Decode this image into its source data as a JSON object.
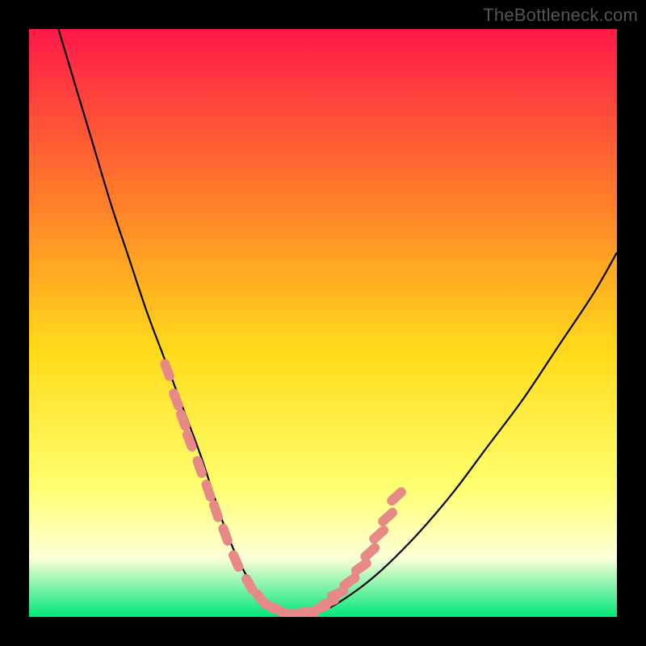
{
  "attribution": "TheBottleneck.com",
  "colors": {
    "frame": "#000000",
    "gradient_top": "#ff1a4a",
    "gradient_mid1": "#ff7a2a",
    "gradient_mid2": "#ffdb1a",
    "gradient_mid3": "#ffff70",
    "gradient_mid4": "#fdffd8",
    "gradient_bottom": "#00e67a",
    "curve": "#000000",
    "marker_fill": "#e78a87",
    "marker_stroke": "#d06a68"
  },
  "chart_data": {
    "type": "line",
    "title": "",
    "xlabel": "",
    "ylabel": "",
    "xlim": [
      0,
      100
    ],
    "ylim": [
      0,
      100
    ],
    "series": [
      {
        "name": "bottleneck-curve",
        "x": [
          5,
          8,
          11,
          14,
          17,
          20,
          23,
          26,
          29,
          31,
          33,
          35,
          37,
          39,
          42,
          46,
          50,
          55,
          60,
          66,
          72,
          78,
          84,
          90,
          96,
          100
        ],
        "y": [
          100,
          90,
          80,
          70,
          61,
          52,
          44,
          36,
          28,
          22,
          16,
          11,
          7,
          4,
          1,
          0,
          1,
          4,
          8,
          14,
          21,
          29,
          37,
          46,
          55,
          62
        ]
      }
    ],
    "markers": {
      "name": "highlighted-segments",
      "x_left": [
        23.5,
        25.0,
        26.2,
        27.3,
        29.0,
        30.5,
        31.8,
        33.4,
        35.2,
        37.5,
        39.5,
        41.0,
        42.8,
        44.5
      ],
      "y_left": [
        42.0,
        37.0,
        33.5,
        30.0,
        25.5,
        21.5,
        18.0,
        14.0,
        9.5,
        5.5,
        3.0,
        1.8,
        1.0,
        0.5
      ],
      "x_right": [
        47.5,
        49.5,
        51.0,
        52.5,
        54.5,
        56.5,
        58.0,
        59.5,
        61.0,
        62.5
      ],
      "y_right": [
        0.8,
        1.5,
        2.5,
        4.0,
        6.0,
        8.5,
        11.0,
        14.0,
        17.0,
        20.5
      ]
    },
    "gradient_stops": [
      {
        "offset": 0.0,
        "color": "#ff1a4a"
      },
      {
        "offset": 0.28,
        "color": "#ff7a2a"
      },
      {
        "offset": 0.55,
        "color": "#ffdb1a"
      },
      {
        "offset": 0.78,
        "color": "#ffff70"
      },
      {
        "offset": 0.9,
        "color": "#fdffd8"
      },
      {
        "offset": 1.0,
        "color": "#00e67a"
      }
    ]
  }
}
